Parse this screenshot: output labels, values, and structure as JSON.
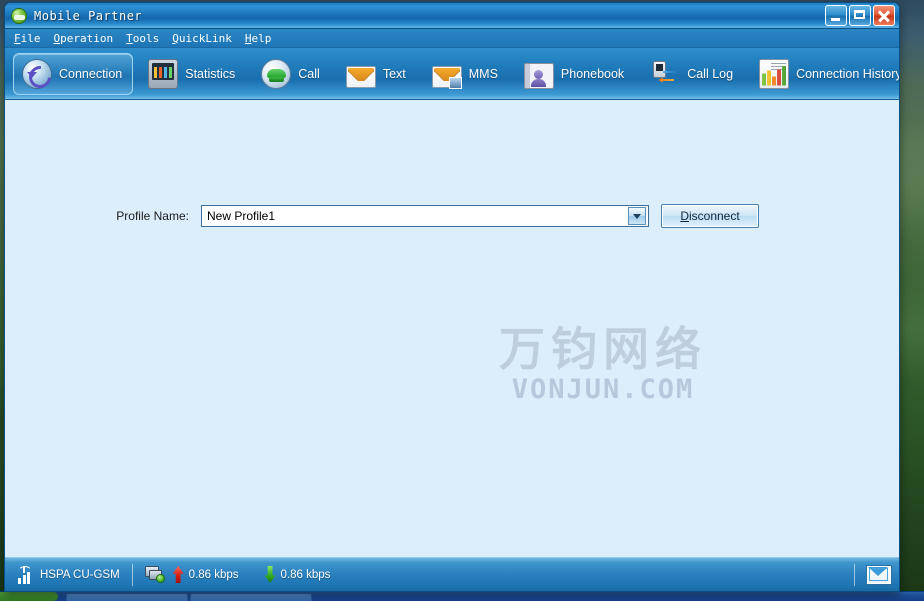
{
  "window": {
    "title": "Mobile Partner",
    "app_icon": "globe-icon",
    "minimize_label": "Minimize",
    "maximize_label": "Maximize",
    "close_label": "Close"
  },
  "menubar": {
    "items": [
      {
        "accel": "F",
        "rest": "ile"
      },
      {
        "accel": "O",
        "rest": "peration"
      },
      {
        "accel": "T",
        "rest": "ools"
      },
      {
        "accel": "Q",
        "rest": "uickLink"
      },
      {
        "accel": "H",
        "rest": "elp"
      }
    ]
  },
  "toolbar": {
    "items": [
      {
        "label": "Connection",
        "icon": "connection-refresh-icon",
        "active": true
      },
      {
        "label": "Statistics",
        "icon": "statistics-monitor-icon",
        "active": false
      },
      {
        "label": "Call",
        "icon": "telephone-icon",
        "active": false
      },
      {
        "label": "Text",
        "icon": "envelope-icon",
        "active": false
      },
      {
        "label": "MMS",
        "icon": "envelope-photo-icon",
        "active": false
      },
      {
        "label": "Phonebook",
        "icon": "address-book-icon",
        "active": false
      },
      {
        "label": "Call Log",
        "icon": "call-log-icon",
        "active": false
      },
      {
        "label": "Connection History",
        "icon": "bar-chart-history-icon",
        "active": false
      }
    ]
  },
  "main": {
    "profile_label": "Profile Name:",
    "profile_value": "New Profile1",
    "profile_placeholder": "New Profile1",
    "disconnect_accel": "D",
    "disconnect_rest": "isconnect"
  },
  "watermark": {
    "chinese": "万钧网络",
    "latin": "VONJUN.COM"
  },
  "statusbar": {
    "signal_icon": "signal-strength-icon",
    "network": "HSPA  CU-GSM",
    "connection_icon": "network-connected-icon",
    "upload_icon": "arrow-up-icon",
    "upload_rate": "0.86 kbps",
    "download_icon": "arrow-down-icon",
    "download_rate": "0.86 kbps",
    "mail_icon": "mail-icon"
  },
  "colors": {
    "titlebar_blue": "#1a72b8",
    "toolbar_blue": "#1c73b2",
    "content_bg": "#dceefb",
    "statusbar_blue": "#2a80be",
    "accent_border": "#9fd4f0",
    "upload_red": "#d81f12",
    "download_green": "#35ad1f"
  }
}
